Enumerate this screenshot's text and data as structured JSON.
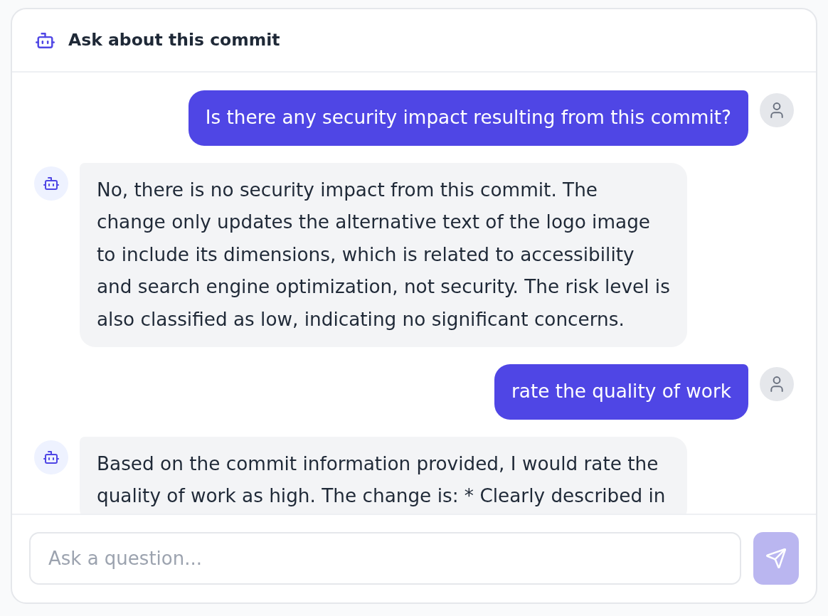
{
  "header": {
    "title": "Ask about this commit"
  },
  "messages": [
    {
      "kind": "user",
      "text": "Is there any security impact resulting from this commit?"
    },
    {
      "kind": "bot",
      "text": "No, there is no security impact from this commit. The change only updates the alternative text of the logo image to include its dimensions, which is related to accessibility and search engine optimization, not security. The risk level is also classified as low, indicating no significant concerns."
    },
    {
      "kind": "user",
      "text": "rate the quality of work"
    },
    {
      "kind": "bot",
      "text": "Based on the commit information provided, I would rate the quality of work as high. The change is: * Clearly described in"
    }
  ],
  "composer": {
    "placeholder": "Ask a question...",
    "send_button": {
      "disabled": true
    }
  }
}
